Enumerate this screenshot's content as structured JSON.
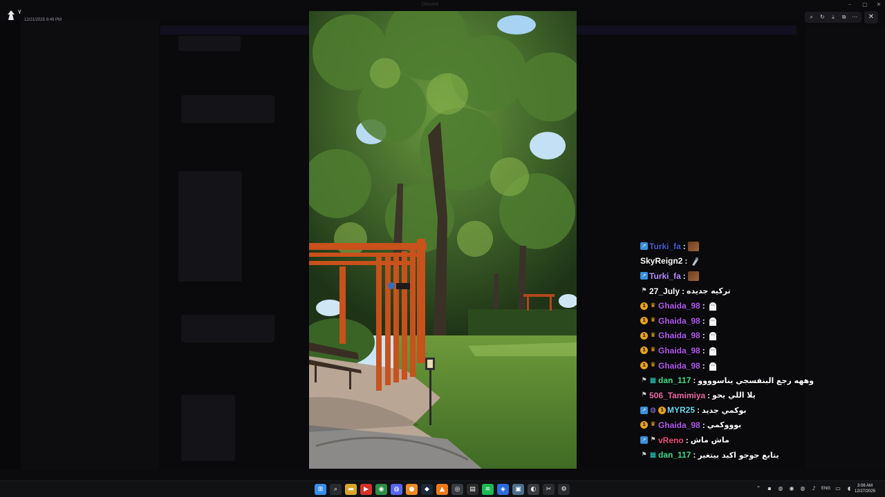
{
  "top": {
    "corner_mark": "٧",
    "corner_date": "12/21/2025 9:49 PM",
    "window_title": "Discord"
  },
  "viewer_toolbar": {
    "buttons": [
      {
        "name": "zoom-icon",
        "glyph": "⌕"
      },
      {
        "name": "rotate-icon",
        "glyph": "↻"
      },
      {
        "name": "download-icon",
        "glyph": "⤓"
      },
      {
        "name": "open-external-icon",
        "glyph": "⧉"
      },
      {
        "name": "more-icon",
        "glyph": "⋯"
      }
    ],
    "close_glyph": "✕"
  },
  "chat": {
    "messages": [
      {
        "user": "Turki_fa",
        "color": "#4a5bd0",
        "badges": [
          "arrow"
        ],
        "message": "",
        "emote": "brown-square-emote"
      },
      {
        "user": "SkyReign2",
        "color": "#ffffff",
        "badges": [],
        "message": "",
        "emote": "figure-emote"
      },
      {
        "user": "Turki_fa",
        "color": "#b98cff",
        "badges": [
          "arrow"
        ],
        "message": "",
        "emote": "brown-square-emote"
      },
      {
        "user": "27_July",
        "color": "#ffffff",
        "badges": [
          "tag"
        ],
        "message": "تركيه جديده",
        "emote": ""
      },
      {
        "user": "Ghaida_98",
        "color": "#b25af0",
        "badges": [
          "circle",
          "crown"
        ],
        "message": "",
        "emote": "white-hand-emote"
      },
      {
        "user": "Ghaida_98",
        "color": "#b25af0",
        "badges": [
          "circle",
          "crown"
        ],
        "message": "",
        "emote": "white-hand-emote"
      },
      {
        "user": "Ghaida_98",
        "color": "#b25af0",
        "badges": [
          "circle",
          "crown"
        ],
        "message": "",
        "emote": "white-hand-emote"
      },
      {
        "user": "Ghaida_98",
        "color": "#b25af0",
        "badges": [
          "circle",
          "crown"
        ],
        "message": "",
        "emote": "white-hand-emote"
      },
      {
        "user": "Ghaida_98",
        "color": "#b25af0",
        "badges": [
          "circle",
          "crown"
        ],
        "message": "",
        "emote": "white-hand-emote"
      },
      {
        "user": "dan_117",
        "color": "#3fe08a",
        "badges": [
          "tag",
          "gift"
        ],
        "message": "وههه رجع البنفسجي يناسوووو",
        "emote": ""
      },
      {
        "user": "506_Tamimiya",
        "color": "#f06aa8",
        "badges": [
          "tag"
        ],
        "message": "يلا اللي يحو",
        "emote": ""
      },
      {
        "user": "MYR25",
        "color": "#6fd8f2",
        "badges": [
          "arrow",
          "bubble",
          "circle"
        ],
        "message": "بوكمي جديد",
        "emote": ""
      },
      {
        "user": "Ghaida_98",
        "color": "#b25af0",
        "badges": [
          "circle",
          "crown"
        ],
        "message": "بوووكمي",
        "emote": ""
      },
      {
        "user": "vReno",
        "color": "#f0507a",
        "badges": [
          "arrow",
          "tag"
        ],
        "message": "ماش ماش",
        "emote": ""
      },
      {
        "user": "dan_117",
        "color": "#3fe08a",
        "badges": [
          "tag",
          "gift"
        ],
        "message": "يتابع جوجو اكيد بيتغير",
        "emote": ""
      }
    ]
  },
  "taskbar": {
    "apps": [
      {
        "name": "start-icon",
        "glyph": "⊞",
        "color": "#3a8ee6"
      },
      {
        "name": "search-icon",
        "glyph": "⌕",
        "color": "#2a2b30"
      },
      {
        "name": "file-explorer-icon",
        "glyph": "▬",
        "color": "#d9a627"
      },
      {
        "name": "red-app-icon",
        "glyph": "▶",
        "color": "#d6322a"
      },
      {
        "name": "chrome-icon",
        "glyph": "◉",
        "color": "#2f8f46"
      },
      {
        "name": "discord-icon",
        "glyph": "◍",
        "color": "#5865f2"
      },
      {
        "name": "orange-app-icon",
        "glyph": "●",
        "color": "#f08a24"
      },
      {
        "name": "steam-icon",
        "glyph": "◆",
        "color": "#1b2838"
      },
      {
        "name": "vlc-icon",
        "glyph": "▲",
        "color": "#ee7a1c"
      },
      {
        "name": "obs-icon",
        "glyph": "◎",
        "color": "#3a3c44"
      },
      {
        "name": "terminal-icon",
        "glyph": "▤",
        "color": "#2b2b2b"
      },
      {
        "name": "spotify-icon",
        "glyph": "≋",
        "color": "#1db954"
      },
      {
        "name": "blue-app-icon",
        "glyph": "◈",
        "color": "#2f6bd9"
      },
      {
        "name": "photos-icon",
        "glyph": "▣",
        "color": "#4b6e8c"
      },
      {
        "name": "active-app-icon",
        "glyph": "◐",
        "color": "#3a3a40"
      },
      {
        "name": "capcut-icon",
        "glyph": "✂",
        "color": "#2a2a2f"
      },
      {
        "name": "settings-icon",
        "glyph": "⚙",
        "color": "#2a2a2f"
      }
    ],
    "tray": [
      {
        "name": "chevron-up-icon",
        "glyph": "⌃"
      },
      {
        "name": "tray-app-icon",
        "glyph": "▪"
      },
      {
        "name": "discord-tray-icon",
        "glyph": "◍"
      },
      {
        "name": "nvidia-tray-icon",
        "glyph": "◉"
      },
      {
        "name": "red-tray-icon",
        "glyph": "◍"
      },
      {
        "name": "mic-icon",
        "glyph": "♪"
      }
    ],
    "language": "ENG",
    "right_tray": [
      {
        "name": "network-icon",
        "glyph": "▭"
      },
      {
        "name": "volume-icon",
        "glyph": "◖"
      }
    ],
    "time": "3:06 AM",
    "date": "12/27/2025"
  }
}
